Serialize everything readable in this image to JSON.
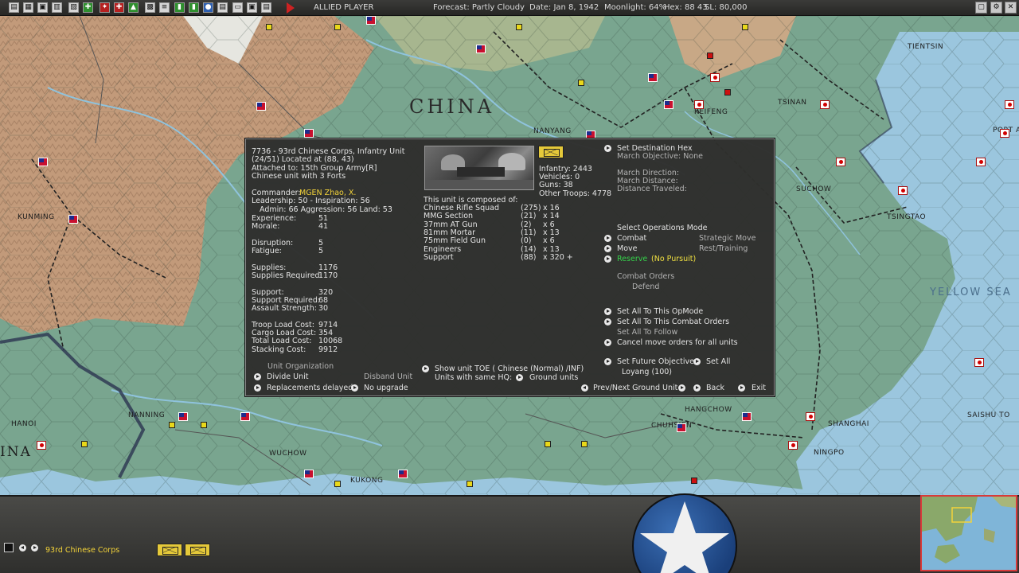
{
  "topbar": {
    "player": "ALLIED PLAYER",
    "forecast": "Forecast: Partly Cloudy",
    "date": "Date: Jan 8, 1942",
    "moonlight": "Moonlight: 64%",
    "hex": "Hex: 88 43",
    "sl": "SL: 80,000"
  },
  "map": {
    "region": "CHINA",
    "sea": "YELLOW SEA",
    "cities": {
      "tientsin": "TIENTSIN",
      "tsinan": "TSINAN",
      "keifeng": "KEIFENG",
      "port_a": "PORT A",
      "nanyang": "NANYANG",
      "suchow": "SUCHOW",
      "tsingtao": "TSINGTAO",
      "kunming": "KUNMING",
      "hanoi": "HANOI",
      "ina": "INA",
      "nanning": "NANNING",
      "wuchow": "WUCHOW",
      "kukong": "KUKONG",
      "hangchow": "HANGCHOW",
      "chuhsien": "CHUHSIEN",
      "shanghai": "SHANGHAI",
      "ningpo": "NINGPO",
      "saishu_to": "SAISHU TO"
    }
  },
  "unit": {
    "title": "7736 - 93rd Chinese Corps, Infantry Unit",
    "location": "(24/51) Located at (88, 43)",
    "attached": "Attached to: 15th Group Army[R]",
    "forts": "Chinese unit with 3 Forts",
    "commander_label": "Commander:",
    "commander_name": "MGEN Zhao, X.",
    "leadership": "Leadership: 50 - Inspiration: 56",
    "admin": "Admin: 66  Aggression: 56  Land: 53",
    "stats": [
      {
        "label": "Experience:",
        "value": "51"
      },
      {
        "label": "Morale:",
        "value": "41"
      },
      {
        "label": "Disruption:",
        "value": "5"
      },
      {
        "label": "Fatigue:",
        "value": "5"
      },
      {
        "label": "Supplies:",
        "value": "1176"
      },
      {
        "label": "Supplies Required:",
        "value": "1170"
      },
      {
        "label": "Support:",
        "value": "320"
      },
      {
        "label": "Support Required:",
        "value": "68"
      },
      {
        "label": "Assault Strength:",
        "value": "30"
      },
      {
        "label": "Troop Load Cost:",
        "value": "9714"
      },
      {
        "label": "Cargo Load Cost:",
        "value": "354"
      },
      {
        "label": "Total Load Cost:",
        "value": "10068"
      },
      {
        "label": "Stacking Cost:",
        "value": "9912"
      }
    ],
    "summary": {
      "infantry": "Infantry: 2443",
      "vehicles": "Vehicles: 0",
      "guns": "Guns: 38",
      "other": "Other Troops: 4778"
    },
    "composed_title": "This unit is composed of:",
    "composition": [
      {
        "name": "Chinese Rifle Squad",
        "ready": "(275)",
        "count": "x 16"
      },
      {
        "name": "MMG Section",
        "ready": "(21)",
        "count": "x 14"
      },
      {
        "name": "37mm AT Gun",
        "ready": "(2)",
        "count": "x 6"
      },
      {
        "name": "81mm Mortar",
        "ready": "(11)",
        "count": "x 13"
      },
      {
        "name": "75mm Field Gun",
        "ready": "(0)",
        "count": "x 6"
      },
      {
        "name": "Engineers",
        "ready": "(14)",
        "count": "x 13"
      },
      {
        "name": "Support",
        "ready": "(88)",
        "count": "x 320 +"
      }
    ]
  },
  "panel_actions": {
    "unit_org_title": "Unit Organization",
    "divide": "Divide Unit",
    "disband": "Disband Unit",
    "replacements": "Replacements delayed",
    "upgrade": "No upgrade",
    "show_toe": "Show unit TOE ( Chinese (Normal) /INF)",
    "same_hq": "Units with same HQ:",
    "ground_units": "Ground units",
    "set_dest": "Set Destination Hex",
    "march_objective": "March Objective: None",
    "march_direction": "March Direction:",
    "march_distance": "March Distance:",
    "distance_traveled": "Distance Traveled:",
    "ops_title": "Select Operations Mode",
    "combat": "Combat",
    "strategic": "Strategic Move",
    "move": "Move",
    "rest": "Rest/Training",
    "reserve": "Reserve",
    "no_pursuit": "(No Pursuit)",
    "combat_orders_title": "Combat Orders",
    "defend": "Defend",
    "set_all_opmode": "Set All To This OpMode",
    "set_all_combat": "Set All To This Combat Orders",
    "set_all_follow": "Set All To Follow",
    "cancel_move": "Cancel move orders for all units",
    "set_future": "Set Future Objective",
    "set_all": "Set All",
    "future_target": "Loyang (100)",
    "prev_next": "Prev/Next Ground Unit",
    "back": "Back",
    "exit": "Exit"
  },
  "bottombar": {
    "unit_name": "93rd Chinese Corps"
  }
}
